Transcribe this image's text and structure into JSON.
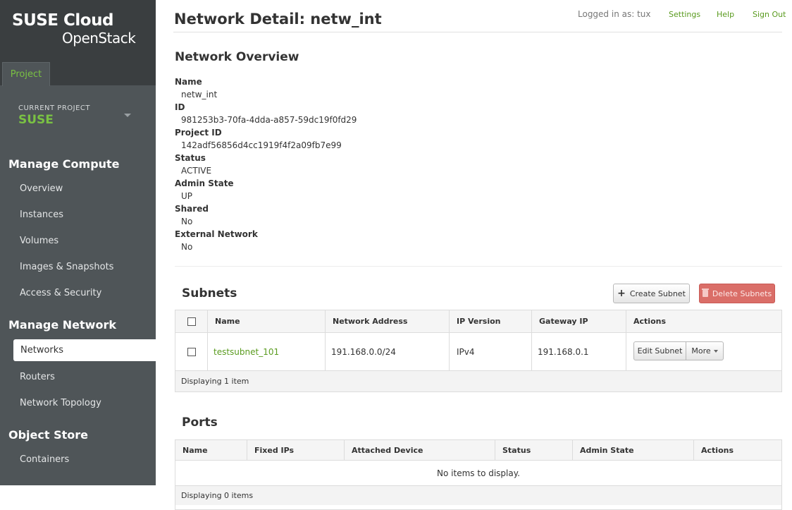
{
  "brand": {
    "line1": "SUSE Cloud",
    "line2": "OpenStack"
  },
  "sidebar": {
    "tab": "Project",
    "current_project_label": "CURRENT PROJECT",
    "current_project_value": "SUSE",
    "groups": [
      {
        "heading": "Manage Compute",
        "items": [
          "Overview",
          "Instances",
          "Volumes",
          "Images & Snapshots",
          "Access & Security"
        ]
      },
      {
        "heading": "Manage Network",
        "items": [
          "Networks",
          "Routers",
          "Network Topology"
        ]
      },
      {
        "heading": "Object Store",
        "items": [
          "Containers"
        ]
      }
    ],
    "active_item": "Networks"
  },
  "header": {
    "title": "Network Detail: netw_int",
    "logged_in": "Logged in as: tux",
    "settings": "Settings",
    "help": "Help",
    "sign_out": "Sign Out"
  },
  "overview": {
    "title": "Network Overview",
    "fields": [
      {
        "label": "Name",
        "value": "netw_int"
      },
      {
        "label": "ID",
        "value": "981253b3-70fa-4dda-a857-59dc19f0fd29"
      },
      {
        "label": "Project ID",
        "value": "142adf56856d4cc1919f4f2a09fb7e99"
      },
      {
        "label": "Status",
        "value": "ACTIVE"
      },
      {
        "label": "Admin State",
        "value": "UP"
      },
      {
        "label": "Shared",
        "value": "No"
      },
      {
        "label": "External Network",
        "value": "No"
      }
    ]
  },
  "subnets": {
    "title": "Subnets",
    "create_label": "Create Subnet",
    "delete_label": "Delete Subnets",
    "columns": [
      "Name",
      "Network Address",
      "IP Version",
      "Gateway IP",
      "Actions"
    ],
    "rows": [
      {
        "name": "testsubnet_101",
        "network_address": "191.168.0.0/24",
        "ip_version": "IPv4",
        "gateway_ip": "191.168.0.1",
        "edit_label": "Edit Subnet",
        "more_label": "More"
      }
    ],
    "footer": "Displaying 1 item"
  },
  "ports": {
    "title": "Ports",
    "columns": [
      "Name",
      "Fixed IPs",
      "Attached Device",
      "Status",
      "Admin State",
      "Actions"
    ],
    "empty": "No items to display.",
    "footer": "Displaying 0 items"
  },
  "colors": {
    "accent": "#7ac143",
    "link": "#5a9b1f",
    "sidebar": "#4f5558",
    "danger": "#da6e68"
  }
}
